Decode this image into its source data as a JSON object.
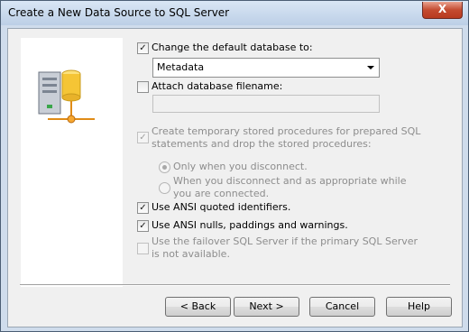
{
  "window": {
    "title": "Create a New Data Source to SQL Server",
    "close_glyph": "X"
  },
  "icons": {
    "database_icon": "database-network-icon",
    "check": "✓"
  },
  "options": {
    "change_db": {
      "label": "Change the default database to:",
      "checked": true
    },
    "database_select": {
      "value": "Metadata"
    },
    "attach_db": {
      "label": "Attach database filename:",
      "checked": false
    },
    "attach_db_input": {
      "value": ""
    },
    "temp_procs": {
      "label": "Create temporary stored procedures for prepared SQL statements and drop the stored procedures:",
      "checked": true,
      "enabled": false
    },
    "radio_disconnect": {
      "label": "Only when you disconnect.",
      "selected": true,
      "enabled": false
    },
    "radio_appropriate": {
      "label": "When you disconnect and as appropriate while you are connected.",
      "selected": false,
      "enabled": false
    },
    "ansi_quoted": {
      "label": "Use ANSI quoted identifiers.",
      "checked": true
    },
    "ansi_nulls": {
      "label": "Use ANSI nulls, paddings and warnings.",
      "checked": true
    },
    "failover": {
      "label": "Use the failover SQL Server if the primary SQL Server is not available.",
      "checked": false,
      "enabled": false
    }
  },
  "buttons": {
    "back": "< Back",
    "next": "Next >",
    "cancel": "Cancel",
    "help": "Help"
  }
}
